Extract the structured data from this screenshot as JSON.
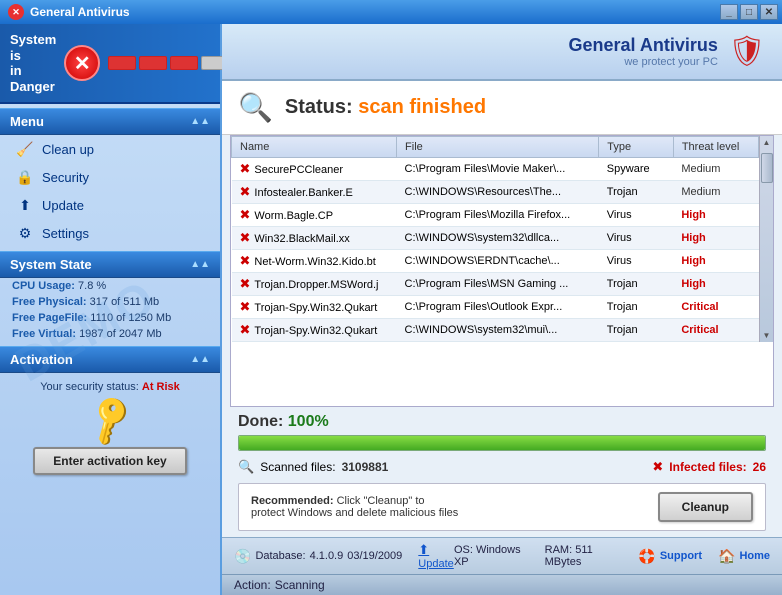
{
  "titleBar": {
    "title": "General Antivirus",
    "buttons": [
      "_",
      "□",
      "✕"
    ]
  },
  "danger": {
    "line1": "System is",
    "line2": "in Danger"
  },
  "logo": {
    "name": "General Antivirus",
    "slogan": "we protect your PC"
  },
  "sidebar": {
    "menuHeader": "Menu",
    "items": [
      {
        "label": "Clean up",
        "icon": "🧹"
      },
      {
        "label": "Security",
        "icon": "🔒"
      },
      {
        "label": "Update",
        "icon": "⬆"
      },
      {
        "label": "Settings",
        "icon": "⚙"
      }
    ],
    "systemStateHeader": "System State",
    "stats": [
      {
        "label": "CPU Usage:",
        "value": "7.8 %"
      },
      {
        "label": "Free Physical:",
        "value": "317 of 511 Mb"
      },
      {
        "label": "Free PageFile:",
        "value": "1110 of 1250 Mb"
      },
      {
        "label": "Free Virtual:",
        "value": "1987 of 2047 Mb"
      }
    ],
    "activationHeader": "Activation",
    "securityStatus": "Your security status:",
    "securityValue": "At Risk",
    "activateButton": "Enter activation key"
  },
  "status": {
    "label": "Status:",
    "value": "scan finished"
  },
  "table": {
    "columns": [
      "Name",
      "File",
      "Type",
      "Threat level"
    ],
    "rows": [
      {
        "name": "SecurePCCleaner",
        "file": "C:\\Program Files\\Movie Maker\\...",
        "type": "Spyware",
        "threat": "Medium",
        "threatClass": "medium"
      },
      {
        "name": "Infostealer.Banker.E",
        "file": "C:\\WINDOWS\\Resources\\The...",
        "type": "Trojan",
        "threat": "Medium",
        "threatClass": "medium"
      },
      {
        "name": "Worm.Bagle.CP",
        "file": "C:\\Program Files\\Mozilla Firefox...",
        "type": "Virus",
        "threat": "High",
        "threatClass": "high"
      },
      {
        "name": "Win32.BlackMail.xx",
        "file": "C:\\WINDOWS\\system32\\dllca...",
        "type": "Virus",
        "threat": "High",
        "threatClass": "high"
      },
      {
        "name": "Net-Worm.Win32.Kido.bt",
        "file": "C:\\WINDOWS\\ERDNT\\cache\\...",
        "type": "Virus",
        "threat": "High",
        "threatClass": "high"
      },
      {
        "name": "Trojan.Dropper.MSWord.j",
        "file": "C:\\Program Files\\MSN Gaming ...",
        "type": "Trojan",
        "threat": "High",
        "threatClass": "high"
      },
      {
        "name": "Trojan-Spy.Win32.Qukart",
        "file": "C:\\Program Files\\Outlook Expr...",
        "type": "Trojan",
        "threat": "Critical",
        "threatClass": "critical"
      },
      {
        "name": "Trojan-Spy.Win32.Qukart",
        "file": "C:\\WINDOWS\\system32\\mui\\...",
        "type": "Trojan",
        "threat": "Critical",
        "threatClass": "critical"
      }
    ]
  },
  "done": {
    "label": "Done:",
    "value": "100%",
    "progress": 100
  },
  "scanned": {
    "label": "Scanned files:",
    "value": "3109881"
  },
  "infected": {
    "label": "Infected files:",
    "value": "26"
  },
  "recommend": {
    "label": "Recommended:",
    "text": "Click \"Cleanup\" to\nprotect Windows and delete malicious files",
    "button": "Cleanup"
  },
  "bottomBar": {
    "dbLabel": "Database:",
    "dbVersion": "4.1.0.9",
    "dbDate": "03/19/2009",
    "updateLabel": "Update",
    "osLabel": "OS:",
    "osValue": "Windows XP",
    "ramLabel": "RAM:",
    "ramValue": "511 MBytes",
    "supportLabel": "Support",
    "homeLabel": "Home"
  },
  "actionBar": {
    "label": "Action:",
    "value": "Scanning"
  }
}
